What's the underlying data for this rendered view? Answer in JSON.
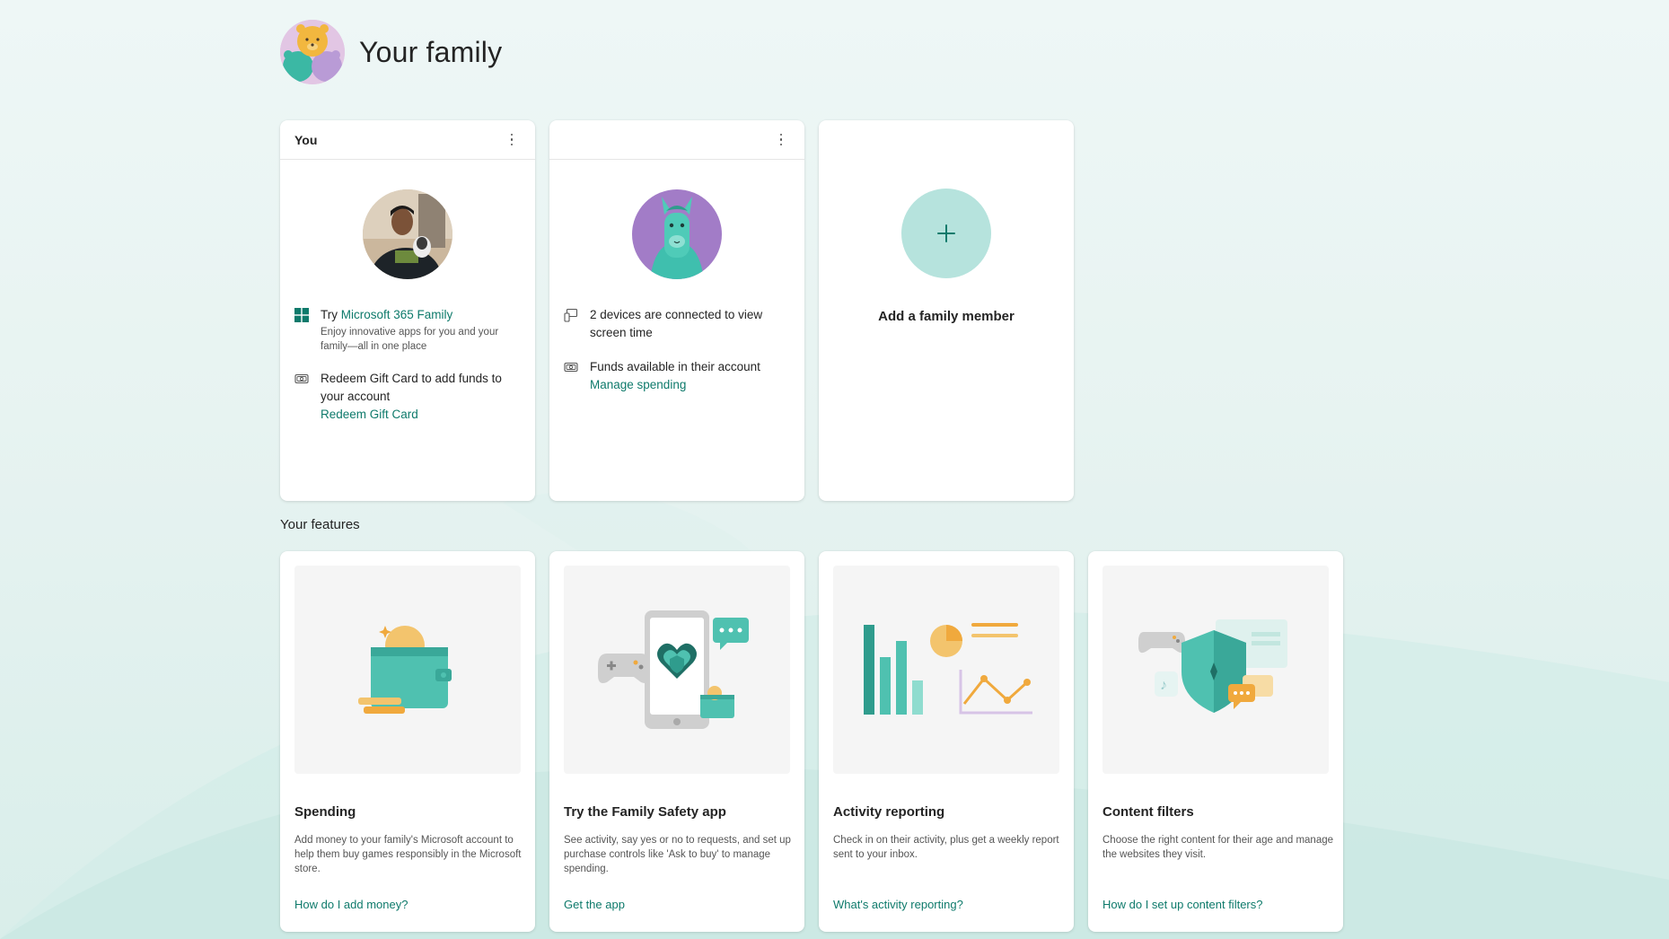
{
  "header": {
    "title": "Your family"
  },
  "members": [
    {
      "name": "You",
      "rows": [
        {
          "prefix": "Try ",
          "link": "Microsoft 365 Family",
          "sub": "Enjoy innovative apps for you and your family—all in one place"
        },
        {
          "text": "Redeem Gift Card to add funds to your account",
          "link": "Redeem Gift Card"
        }
      ]
    },
    {
      "name": "",
      "rows": [
        {
          "text": "2 devices are connected to view screen time"
        },
        {
          "text": "Funds available in their account",
          "link": "Manage spending"
        }
      ]
    }
  ],
  "add_member": {
    "label": "Add a family member",
    "icon": "plus-icon"
  },
  "features_title": "Your features",
  "features": [
    {
      "title": "Spending",
      "desc": "Add money to your family's Microsoft account to help them buy games responsibly in the Microsoft store.",
      "link": "How do I add money?"
    },
    {
      "title": "Try the Family Safety app",
      "desc": "See activity, say yes or no to requests, and set up purchase controls like 'Ask to buy' to manage spending.",
      "link": "Get the app"
    },
    {
      "title": "Activity reporting",
      "desc": "Check in on their activity, plus get a weekly report sent to your inbox.",
      "link": "What's activity reporting?"
    },
    {
      "title": "Content filters",
      "desc": "Choose the right content for their age and manage the websites they visit.",
      "link": "How do I set up content filters?"
    }
  ],
  "colors": {
    "accent": "#0e7a6b",
    "teal": "#3fbfae",
    "background": "#eef7f6"
  }
}
